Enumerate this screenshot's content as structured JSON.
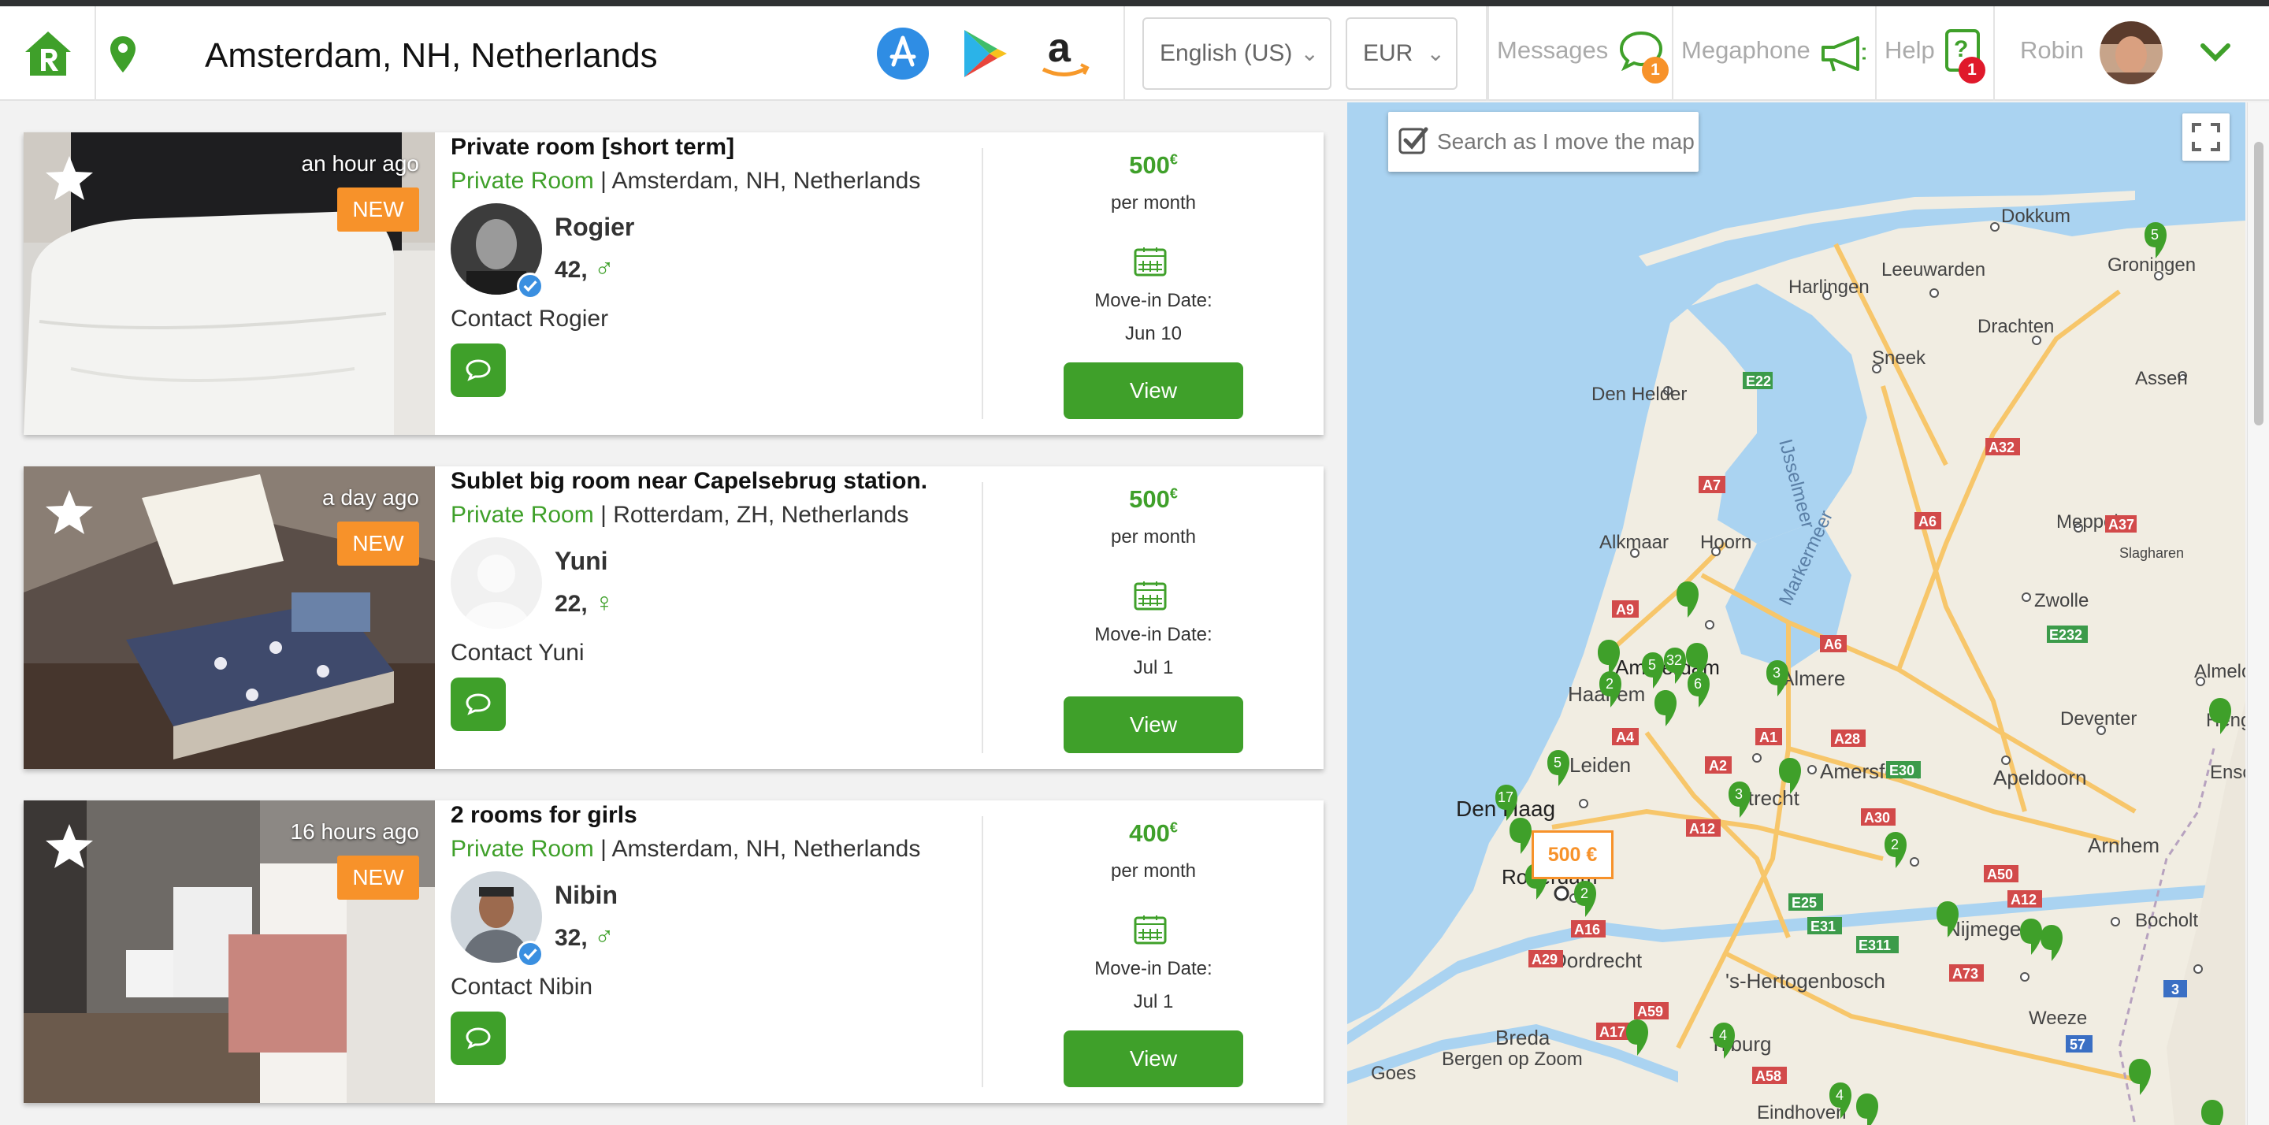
{
  "colors": {
    "brand_green": "#3fa02a",
    "accent_orange": "#f7922a",
    "badge_red": "#e0192b",
    "verified_blue": "#3a8fe0"
  },
  "header": {
    "location": "Amsterdam, NH, Netherlands",
    "stores": [
      "app-store-icon",
      "google-play-icon",
      "amazon-icon"
    ],
    "language": "English (US)",
    "currency": "EUR",
    "messages_label": "Messages",
    "messages_count": "1",
    "megaphone_label": "Megaphone",
    "help_label": "Help",
    "help_count": "1",
    "user_name": "Robin"
  },
  "listings": [
    {
      "title": "Private room [short term]",
      "type": "Private Room",
      "location": "Amsterdam, NH, Netherlands",
      "posted": "an hour ago",
      "badge": "NEW",
      "host": "Rogier",
      "age": "42,",
      "gender": "♂",
      "verified": true,
      "contact": "Contact Rogier",
      "price": "500",
      "currency_symbol": "€",
      "period": "per month",
      "movein_label": "Move-in Date:",
      "movein_date": "Jun 10",
      "view_label": "View"
    },
    {
      "title": "Sublet big room near Capelsebrug station.",
      "type": "Private Room",
      "location": "Rotterdam, ZH, Netherlands",
      "posted": "a day ago",
      "badge": "NEW",
      "host": "Yuni",
      "age": "22,",
      "gender": "♀",
      "verified": false,
      "contact": "Contact Yuni",
      "price": "500",
      "currency_symbol": "€",
      "period": "per month",
      "movein_label": "Move-in Date:",
      "movein_date": "Jul 1",
      "view_label": "View"
    },
    {
      "title": "2 rooms for girls",
      "type": "Private Room",
      "location": "Amsterdam, NH, Netherlands",
      "posted": "16 hours ago",
      "badge": "NEW",
      "host": "Nibin",
      "age": "32,",
      "gender": "♂",
      "verified": true,
      "contact": "Contact Nibin",
      "price": "400",
      "currency_symbol": "€",
      "period": "per month",
      "movein_label": "Move-in Date:",
      "movein_date": "Jul 1",
      "view_label": "View"
    }
  ],
  "map": {
    "search_toggle_label": "Search as I move the map",
    "search_toggle_checked": true,
    "price_tag": "500 €",
    "cities": [
      "Dokkum",
      "Groningen",
      "Leeuwarden",
      "Harlingen",
      "Drachten",
      "Sneek",
      "Assen",
      "Den Helder",
      "Meppel",
      "Slagharen",
      "Alkmaar",
      "Hoorn",
      "Zwolle",
      "Amsterdam",
      "Almere",
      "Haarlem",
      "Almelo",
      "Deventer",
      "Hengelo",
      "Enschede",
      "Leiden",
      "Amersfoort",
      "Apeldoorn",
      "Utrecht",
      "Den Haag",
      "Arnhem",
      "Rotterdam",
      "Dordrecht",
      "Nijmegen",
      "Bocholt",
      "'s-Hertogenbosch",
      "Weeze",
      "Breda",
      "Tilburg",
      "Bergen op Zoom",
      "Goes",
      "Eindhoven"
    ],
    "water_labels": [
      "IJsselmeer",
      "Markermeer"
    ],
    "roads": [
      "E22",
      "A32",
      "A7",
      "A6",
      "A37",
      "A9",
      "E232",
      "A4",
      "A6",
      "A1",
      "A28",
      "E30",
      "A2",
      "A12",
      "A30",
      "A16",
      "A50",
      "A12",
      "E25",
      "E31",
      "E311",
      "A73",
      "A29",
      "A59",
      "A17",
      "A58",
      "57",
      "3"
    ],
    "markers": [
      "5",
      "2",
      "5",
      "32",
      "6",
      "3",
      "5",
      "17",
      "2",
      "3",
      "2",
      "4",
      "4"
    ]
  }
}
